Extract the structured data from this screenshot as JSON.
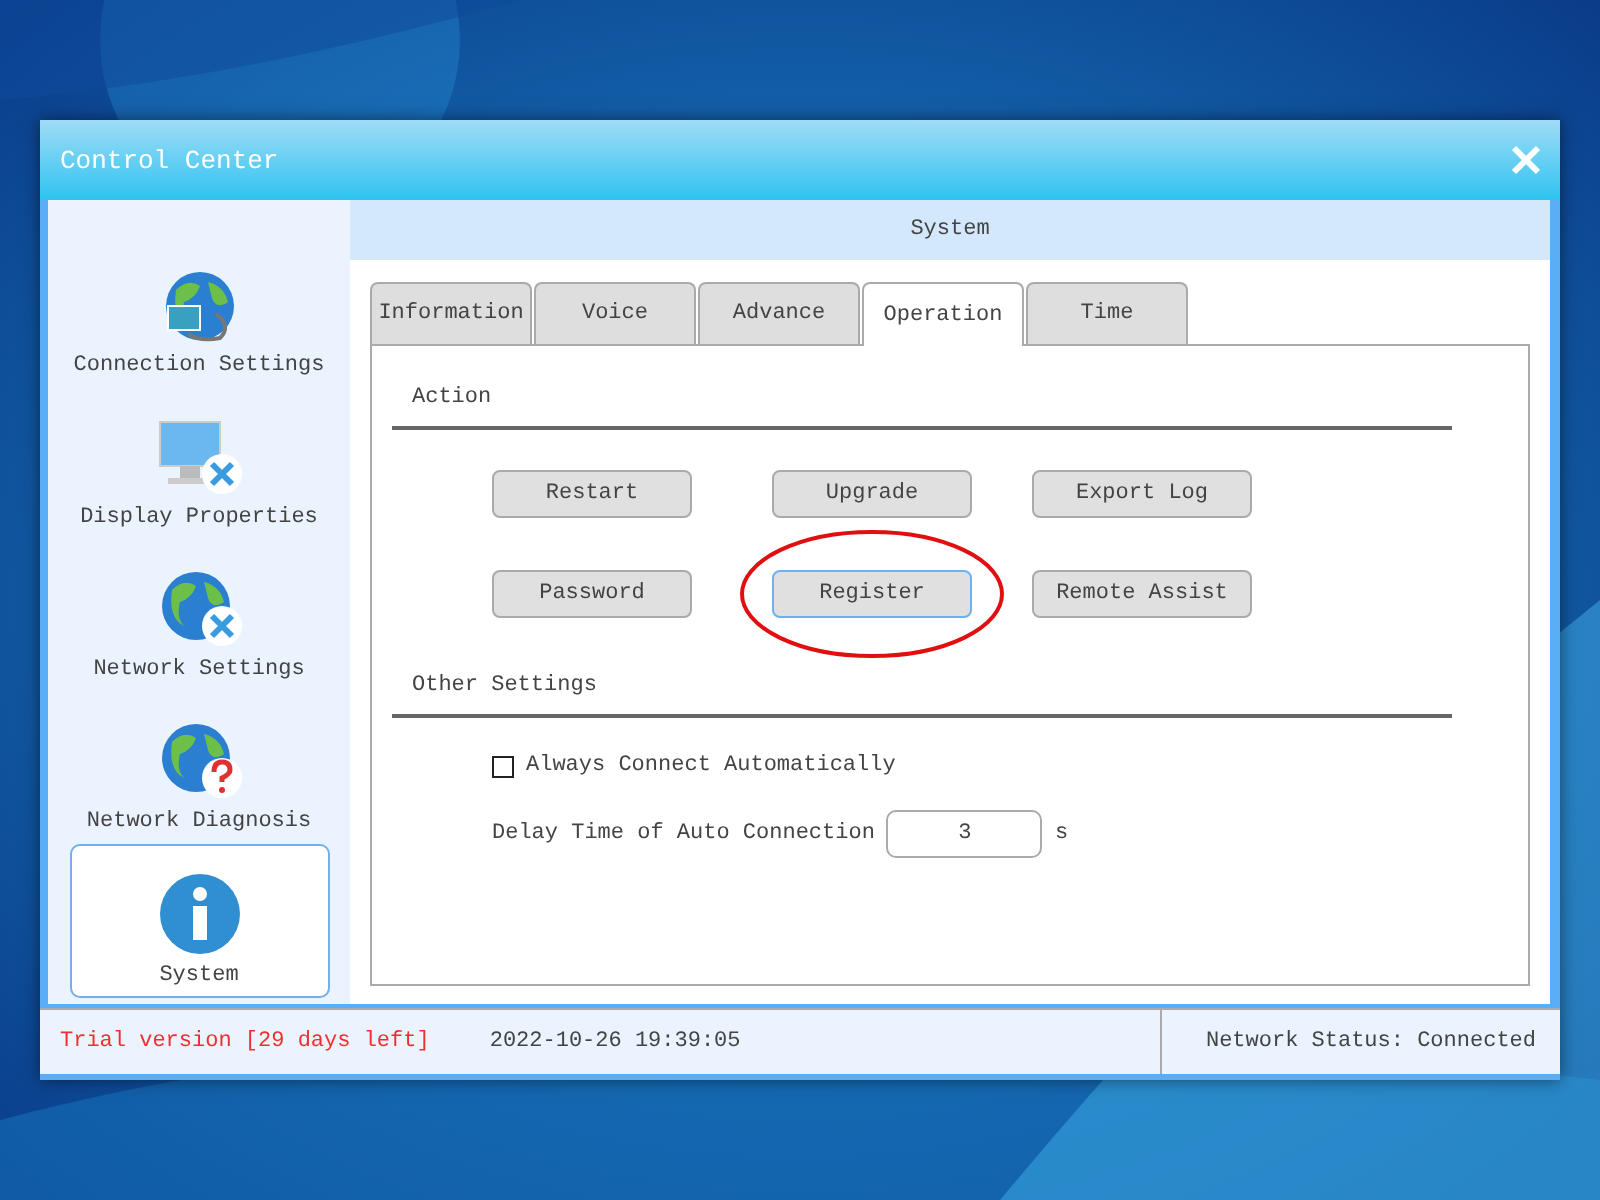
{
  "window": {
    "title": "Control Center"
  },
  "sidebar": {
    "items": [
      {
        "label": "Connection Settings",
        "selected": false
      },
      {
        "label": "Display Properties",
        "selected": false
      },
      {
        "label": "Network Settings",
        "selected": false
      },
      {
        "label": "Network Diagnosis",
        "selected": false
      },
      {
        "label": "System",
        "selected": true
      }
    ]
  },
  "header": "System",
  "tabs": [
    {
      "label": "Information",
      "selected": false
    },
    {
      "label": "Voice",
      "selected": false
    },
    {
      "label": "Advance",
      "selected": false
    },
    {
      "label": "Operation",
      "selected": true
    },
    {
      "label": "Time",
      "selected": false
    }
  ],
  "action_section": {
    "title": "Action",
    "buttons": [
      {
        "label": "Restart",
        "focused": false,
        "circled": false
      },
      {
        "label": "Upgrade",
        "focused": false,
        "circled": false
      },
      {
        "label": "Export Log",
        "focused": false,
        "circled": false
      },
      {
        "label": "Password",
        "focused": false,
        "circled": false
      },
      {
        "label": "Register",
        "focused": true,
        "circled": true
      },
      {
        "label": "Remote Assist",
        "focused": false,
        "circled": false
      }
    ]
  },
  "other_section": {
    "title": "Other Settings",
    "checkbox": {
      "label": "Always Connect Automatically",
      "checked": false
    },
    "delay": {
      "label": "Delay Time of Auto Connection",
      "value": "3",
      "unit": "s"
    }
  },
  "status_bar": {
    "trial": "Trial version [29 days left]",
    "datetime": "2022-10-26 19:39:05",
    "network_status": "Network Status: Connected"
  }
}
